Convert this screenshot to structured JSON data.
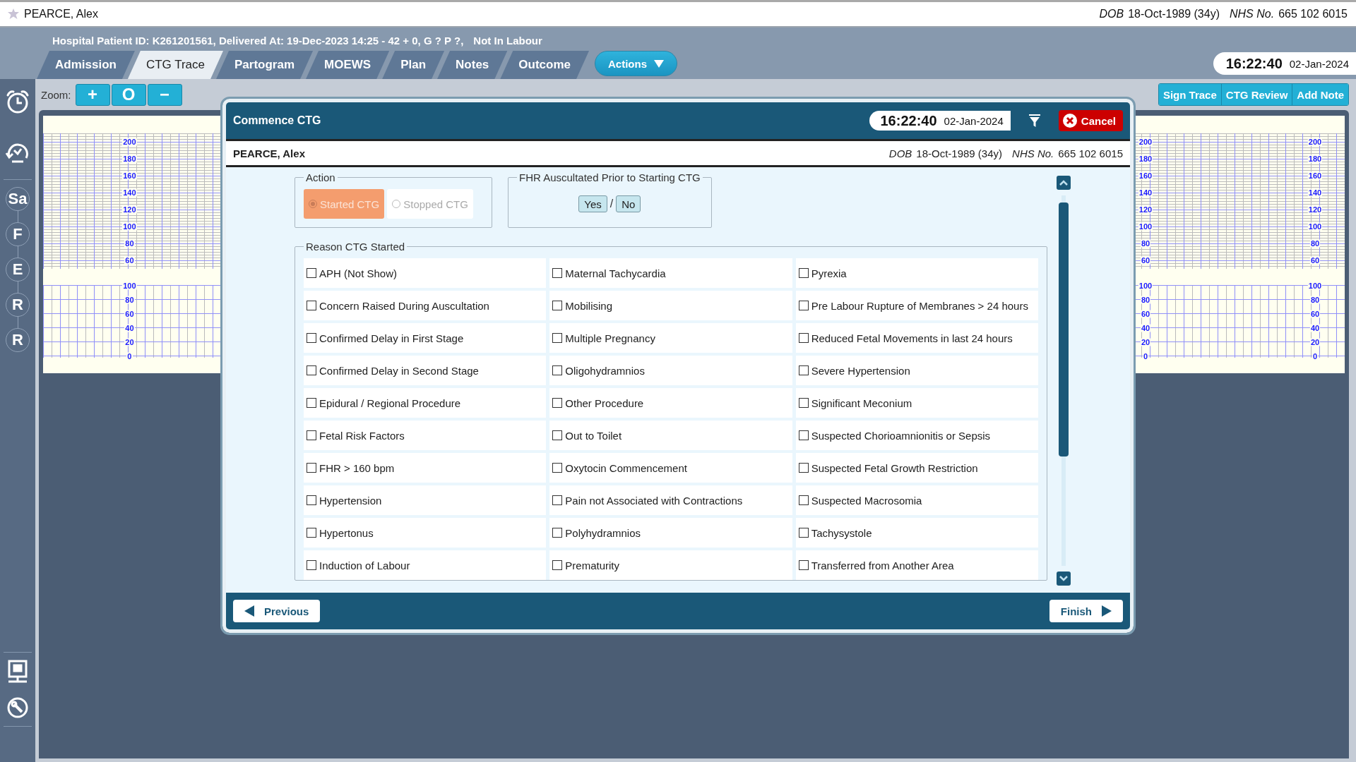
{
  "top_bar": {
    "patient_name": "PEARCE, Alex",
    "dob_label": "DOB",
    "dob": "18-Oct-1989 (34y)",
    "nhs_label": "NHS No.",
    "nhs_number": "665 102 6015"
  },
  "header": {
    "info": "Hospital Patient ID: K261201561, Delivered At: 19-Dec-2023 14:25 - 42 + 0, G ? P ?,",
    "status": "Not In Labour"
  },
  "tabs": [
    {
      "label": "Admission",
      "selected": false
    },
    {
      "label": "CTG Trace",
      "selected": true
    },
    {
      "label": "Partogram",
      "selected": false
    },
    {
      "label": "MOEWS",
      "selected": false
    },
    {
      "label": "Plan",
      "selected": false
    },
    {
      "label": "Notes",
      "selected": false
    },
    {
      "label": "Outcome",
      "selected": false
    }
  ],
  "actions_button": "Actions",
  "clock": {
    "time": "16:22:40",
    "date": "02-Jan-2024"
  },
  "sidebar": {
    "letters": [
      "Sa",
      "F",
      "E",
      "R",
      "R"
    ]
  },
  "zoom": {
    "label": "Zoom:",
    "buttons": [
      "+",
      "O",
      "−"
    ]
  },
  "toolbar_buttons": [
    "Sign Trace",
    "CTG Review",
    "Add Note"
  ],
  "traces": [
    {
      "scales": [
        {
          "fhr": [
            "200",
            "180",
            "160",
            "140",
            "120",
            "100",
            "80",
            "60"
          ],
          "toco": [
            "100",
            "80",
            "60",
            "40",
            "20",
            "0"
          ]
        }
      ]
    },
    {
      "scales": [
        {
          "fhr": [
            "200",
            "180",
            "160",
            "140",
            "120",
            "100",
            "80",
            "60"
          ],
          "toco": [
            "100",
            "80",
            "60",
            "40",
            "20",
            "0"
          ]
        },
        {
          "fhr": [
            "200",
            "180",
            "160",
            "140",
            "120",
            "100",
            "80",
            "60"
          ],
          "toco": [
            "100",
            "80",
            "60",
            "40",
            "20",
            "0"
          ]
        }
      ]
    }
  ],
  "dialog": {
    "title": "Commence CTG",
    "time": "16:22:40",
    "date": "02-Jan-2024",
    "cancel": "Cancel",
    "patient": {
      "name": "PEARCE, Alex",
      "dob_label": "DOB",
      "dob": "18-Oct-1989 (34y)",
      "nhs_label": "NHS No.",
      "nhs_number": "665 102 6015"
    },
    "action": {
      "legend": "Action",
      "options": [
        {
          "label": "Started CTG",
          "selected": true
        },
        {
          "label": "Stopped CTG",
          "selected": false
        }
      ]
    },
    "fhr_auscultated": {
      "legend": "FHR Auscultated Prior to Starting CTG",
      "separator": "/",
      "options": [
        {
          "label": "Yes",
          "selected": false
        },
        {
          "label": "No",
          "selected": false
        }
      ]
    },
    "reasons": {
      "legend": "Reason CTG Started",
      "items": [
        {
          "label": "APH (Not Show)",
          "checked": false
        },
        {
          "label": "Maternal Tachycardia",
          "checked": false
        },
        {
          "label": "Pyrexia",
          "checked": false
        },
        {
          "label": "Concern Raised During Auscultation",
          "checked": false
        },
        {
          "label": "Mobilising",
          "checked": false
        },
        {
          "label": "Pre Labour Rupture of Membranes > 24 hours",
          "checked": false
        },
        {
          "label": "Confirmed Delay in First Stage",
          "checked": false
        },
        {
          "label": "Multiple Pregnancy",
          "checked": false
        },
        {
          "label": "Reduced Fetal Movements in last 24 hours",
          "checked": false
        },
        {
          "label": "Confirmed Delay in Second Stage",
          "checked": false
        },
        {
          "label": "Oligohydramnios",
          "checked": false
        },
        {
          "label": "Severe Hypertension",
          "checked": false
        },
        {
          "label": "Epidural / Regional Procedure",
          "checked": false
        },
        {
          "label": "Other Procedure",
          "checked": false
        },
        {
          "label": "Significant Meconium",
          "checked": false
        },
        {
          "label": "Fetal Risk Factors",
          "checked": false
        },
        {
          "label": "Out to Toilet",
          "checked": false
        },
        {
          "label": "Suspected Chorioamnionitis or Sepsis",
          "checked": false
        },
        {
          "label": "FHR > 160 bpm",
          "checked": false
        },
        {
          "label": "Oxytocin Commencement",
          "checked": false
        },
        {
          "label": "Suspected Fetal Growth Restriction",
          "checked": false
        },
        {
          "label": "Hypertension",
          "checked": false
        },
        {
          "label": "Pain not Associated with Contractions",
          "checked": false
        },
        {
          "label": "Suspected Macrosomia",
          "checked": false
        },
        {
          "label": "Hypertonus",
          "checked": false
        },
        {
          "label": "Polyhydramnios",
          "checked": false
        },
        {
          "label": "Tachysystole",
          "checked": false
        },
        {
          "label": "Induction of Labour",
          "checked": false
        },
        {
          "label": "Prematurity",
          "checked": false
        },
        {
          "label": "Transferred from Another Area",
          "checked": false
        }
      ]
    },
    "previous": "Previous",
    "finish": "Finish"
  }
}
